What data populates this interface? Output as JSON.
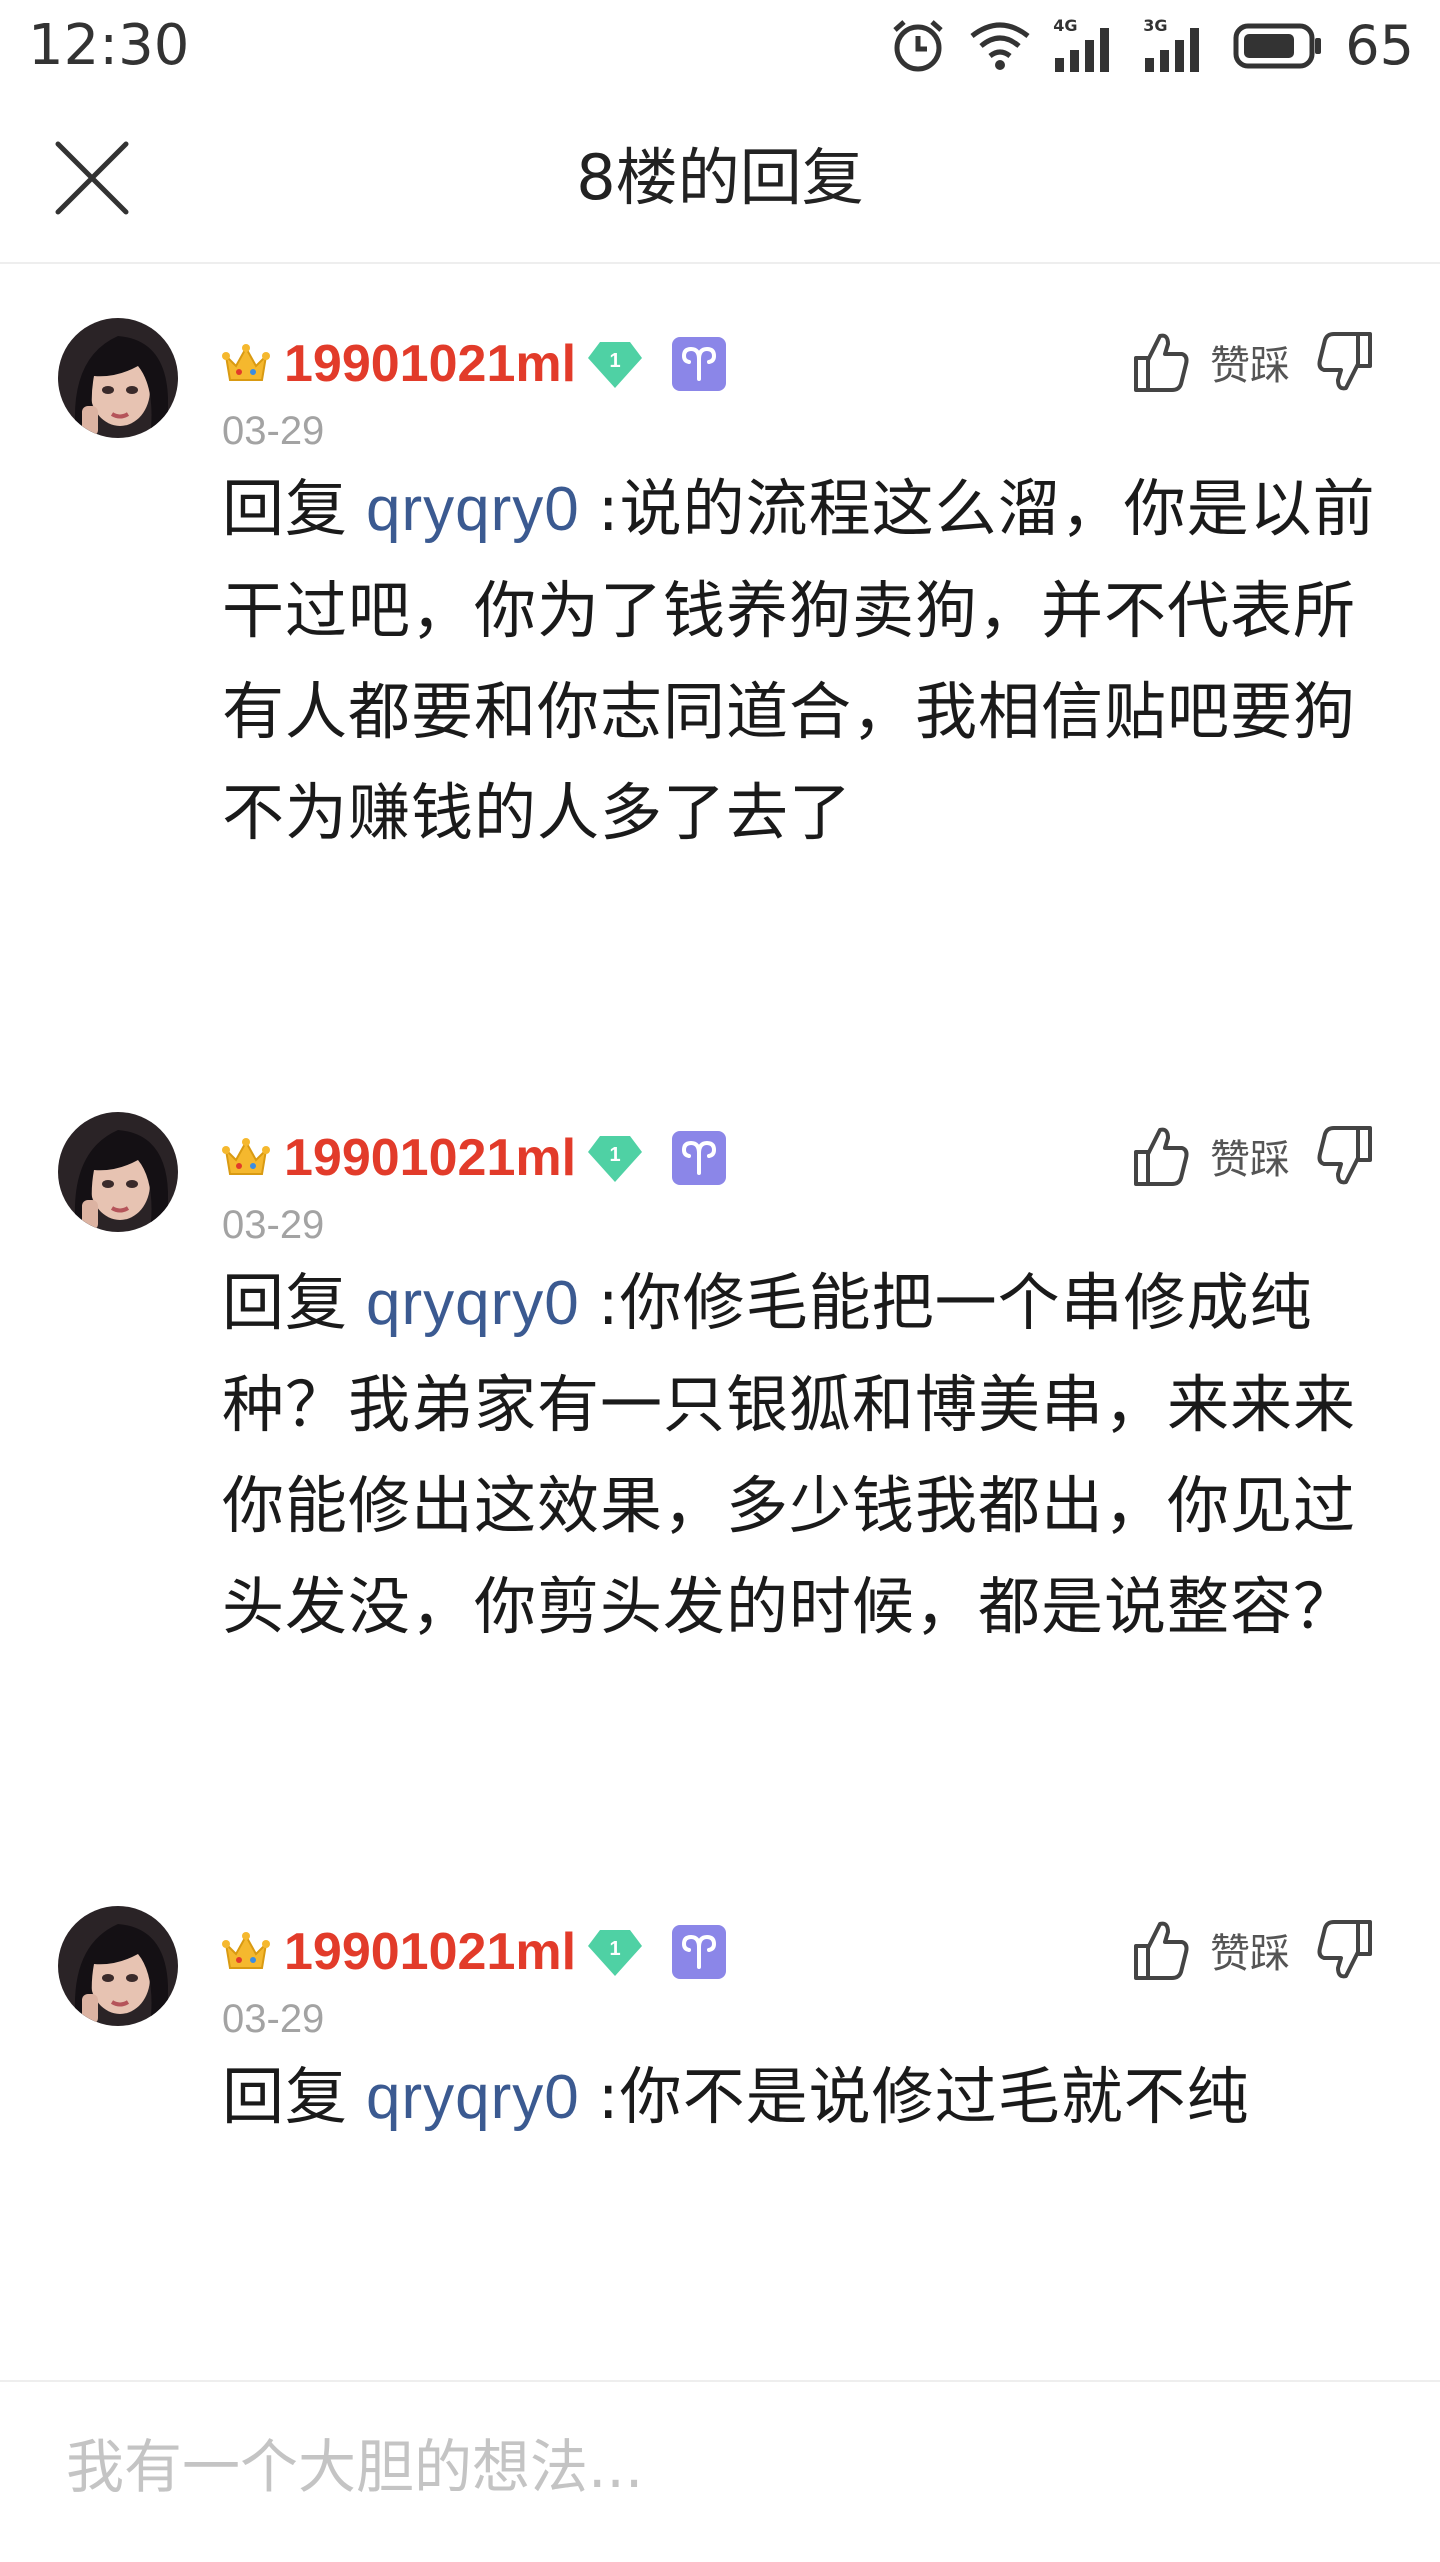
{
  "status_bar": {
    "time": "12:30",
    "network_4g": "4G",
    "network_3g": "3G",
    "battery": "65"
  },
  "header": {
    "title": "8楼的回复"
  },
  "comments": [
    {
      "username": "19901021ml",
      "level": "1",
      "date": "03-29",
      "vote_label": "赞踩",
      "reply_prefix": "回复",
      "reply_target": "qryqry0",
      "text": ":说的流程这么溜，你是以前干过吧，你为了钱养狗卖狗，并不代表所有人都要和你志同道合，我相信贴吧要狗不为赚钱的人多了去了"
    },
    {
      "username": "19901021ml",
      "level": "1",
      "date": "03-29",
      "vote_label": "赞踩",
      "reply_prefix": "回复",
      "reply_target": "qryqry0",
      "text": ":你修毛能把一个串修成纯种？我弟家有一只银狐和博美串，来来来你能修出这效果，多少钱我都出，你见过头发没，你剪头发的时候，都是说整容？"
    },
    {
      "username": "19901021ml",
      "level": "1",
      "date": "03-29",
      "vote_label": "赞踩",
      "reply_prefix": "回复",
      "reply_target": "qryqry0",
      "text": ":你不是说修过毛就不纯"
    }
  ],
  "reply_box": {
    "placeholder": "我有一个大胆的想法..."
  },
  "colors": {
    "username": "#e23b2a",
    "reply_target": "#3b5a91",
    "date": "#a3a3a3",
    "level_badge": "#4fd1a4",
    "zodiac_badge": "#8b86e8"
  },
  "icons": {
    "header_close": "close-icon",
    "vip": "crown-icon",
    "zodiac": "aries-icon",
    "like": "thumbs-up-icon",
    "dislike": "thumbs-down-icon"
  }
}
